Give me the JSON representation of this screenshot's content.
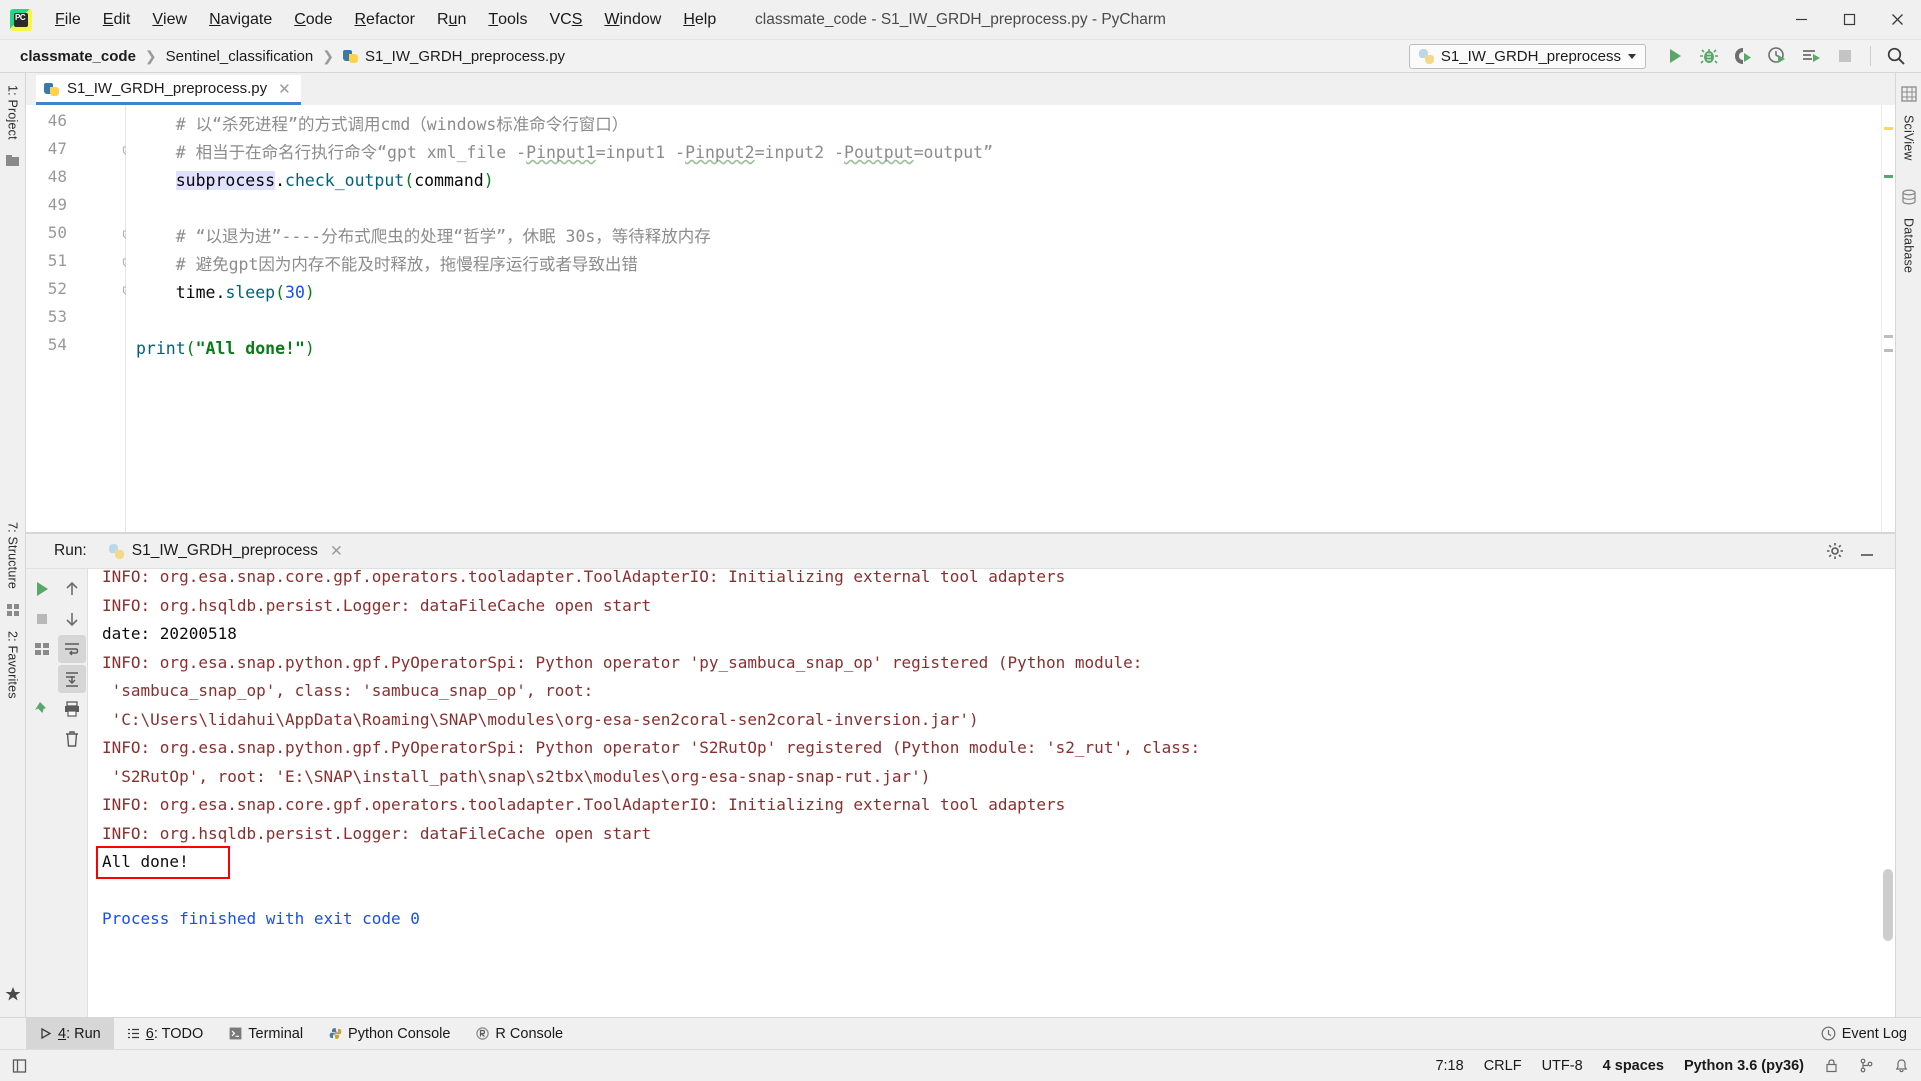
{
  "window": {
    "title": "classmate_code - S1_IW_GRDH_preprocess.py - PyCharm",
    "app_icon": "pycharm-icon",
    "minimize": "─",
    "maximize": "☐",
    "close": "✕"
  },
  "menubar": {
    "items": [
      {
        "label": "File",
        "mnemonic": "F"
      },
      {
        "label": "Edit",
        "mnemonic": "E"
      },
      {
        "label": "View",
        "mnemonic": "V"
      },
      {
        "label": "Navigate",
        "mnemonic": "N"
      },
      {
        "label": "Code",
        "mnemonic": "C"
      },
      {
        "label": "Refactor",
        "mnemonic": "R"
      },
      {
        "label": "Run",
        "mnemonic": "u"
      },
      {
        "label": "Tools",
        "mnemonic": "T"
      },
      {
        "label": "VCS",
        "mnemonic": "S"
      },
      {
        "label": "Window",
        "mnemonic": "W"
      },
      {
        "label": "Help",
        "mnemonic": "H"
      }
    ]
  },
  "breadcrumb": {
    "project": "classmate_code",
    "folder": "Sentinel_classification",
    "file": "S1_IW_GRDH_preprocess.py"
  },
  "toolbar": {
    "run_config": "S1_IW_GRDH_preprocess",
    "buttons": [
      {
        "name": "run-button",
        "tooltip": "Run"
      },
      {
        "name": "debug-button",
        "tooltip": "Debug"
      },
      {
        "name": "run-with-coverage-button",
        "tooltip": "Run with Coverage"
      },
      {
        "name": "profile-button",
        "tooltip": "Profile"
      },
      {
        "name": "run-with-console-button",
        "tooltip": "Run with Console"
      },
      {
        "name": "stop-button",
        "tooltip": "Stop"
      },
      {
        "name": "search-everywhere-button",
        "tooltip": "Search Everywhere"
      }
    ]
  },
  "left_rail": {
    "project_label": "1: Project",
    "structure_label": "7: Structure",
    "favorites_label": "2: Favorites"
  },
  "right_rail": {
    "sciview_label": "SciView",
    "database_label": "Database"
  },
  "editor": {
    "tab_label": "S1_IW_GRDH_preprocess.py",
    "tab_close": "✕",
    "lines": [
      {
        "number": "46",
        "fold": false,
        "tokens": [
          {
            "t": "    # 以“杀死进程”的方式调用cmd（windows标准命令行窗口）",
            "c": "c-com"
          }
        ]
      },
      {
        "number": "47",
        "fold": true,
        "tokens": [
          {
            "t": "    # 相当于在命名行执行命令“gpt xml_file -",
            "c": "c-com"
          },
          {
            "t": "Pinput1",
            "c": "c-com squig"
          },
          {
            "t": "=input1 -",
            "c": "c-com"
          },
          {
            "t": "Pinput2",
            "c": "c-com squig"
          },
          {
            "t": "=input2 -",
            "c": "c-com"
          },
          {
            "t": "Poutput",
            "c": "c-com squig"
          },
          {
            "t": "=output”",
            "c": "c-com"
          }
        ]
      },
      {
        "number": "48",
        "fold": false,
        "tokens": [
          {
            "t": "    ",
            "c": "c-pln"
          },
          {
            "t": "subprocess",
            "c": "c-pln c-hl"
          },
          {
            "t": ".",
            "c": "c-pln"
          },
          {
            "t": "check_output",
            "c": "c-fn"
          },
          {
            "t": "(",
            "c": "c-par"
          },
          {
            "t": "command",
            "c": "c-pln"
          },
          {
            "t": ")",
            "c": "c-par"
          }
        ]
      },
      {
        "number": "49",
        "fold": false,
        "tokens": []
      },
      {
        "number": "50",
        "fold": true,
        "tokens": [
          {
            "t": "    # “以退为进”----分布式爬虫的处理“哲学”，休眠 30s，等待释放内存",
            "c": "c-com"
          }
        ]
      },
      {
        "number": "51",
        "fold": true,
        "tokens": [
          {
            "t": "    # 避免gpt因为内存不能及时释放，拖慢程序运行或者导致出错",
            "c": "c-com"
          }
        ]
      },
      {
        "number": "52",
        "fold": true,
        "tokens": [
          {
            "t": "    ",
            "c": "c-pln"
          },
          {
            "t": "time",
            "c": "c-pln"
          },
          {
            "t": ".",
            "c": "c-pln"
          },
          {
            "t": "sleep",
            "c": "c-fn"
          },
          {
            "t": "(",
            "c": "c-par"
          },
          {
            "t": "30",
            "c": "c-num"
          },
          {
            "t": ")",
            "c": "c-par"
          }
        ]
      },
      {
        "number": "53",
        "fold": false,
        "tokens": []
      },
      {
        "number": "54",
        "fold": false,
        "tokens": [
          {
            "t": "print",
            "c": "c-fn"
          },
          {
            "t": "(",
            "c": "c-par"
          },
          {
            "t": "\"All done!\"",
            "c": "c-str"
          },
          {
            "t": ")",
            "c": "c-par"
          }
        ]
      }
    ]
  },
  "run_window": {
    "label": "Run:",
    "tab_title": "S1_IW_GRDH_preprocess",
    "tab_close": "✕",
    "settings_icon": "gear-icon",
    "minimize_icon": "minimize-icon",
    "rail_buttons": [
      {
        "name": "rerun-button",
        "tooltip": "Rerun"
      },
      {
        "name": "stop-button",
        "tooltip": "Stop"
      },
      {
        "name": "scroll-up-button",
        "tooltip": "Up the Stack Trace"
      },
      {
        "name": "scroll-down-button",
        "tooltip": "Down the Stack Trace"
      },
      {
        "name": "soft-wrap-button",
        "tooltip": "Soft-Wrap"
      },
      {
        "name": "scroll-to-end-button",
        "tooltip": "Scroll to End"
      },
      {
        "name": "print-button",
        "tooltip": "Print"
      },
      {
        "name": "pin-tab-button",
        "tooltip": "Pin Tab"
      },
      {
        "name": "clear-all-button",
        "tooltip": "Clear All"
      }
    ],
    "console_lines": [
      {
        "text": "INFO: org.esa.snap.core.gpf.operators.tooladapter.ToolAdapterIO: Initializing external tool adapters",
        "color": "t-info",
        "clipped": true
      },
      {
        "text": "INFO: org.hsqldb.persist.Logger: dataFileCache open start",
        "color": "t-info"
      },
      {
        "text": "date: 20200518",
        "color": "t-black"
      },
      {
        "text": "INFO: org.esa.snap.python.gpf.PyOperatorSpi: Python operator 'py_sambuca_snap_op' registered (Python module:",
        "color": "t-info"
      },
      {
        "text": " 'sambuca_snap_op', class: 'sambuca_snap_op', root:",
        "color": "t-info"
      },
      {
        "text": " 'C:\\Users\\lidahui\\AppData\\Roaming\\SNAP\\modules\\org-esa-sen2coral-sen2coral-inversion.jar')",
        "color": "t-info"
      },
      {
        "text": "INFO: org.esa.snap.python.gpf.PyOperatorSpi: Python operator 'S2RutOp' registered (Python module: 's2_rut', class:",
        "color": "t-info"
      },
      {
        "text": " 'S2RutOp', root: 'E:\\SNAP\\install_path\\snap\\s2tbx\\modules\\org-esa-snap-snap-rut.jar')",
        "color": "t-info"
      },
      {
        "text": "INFO: org.esa.snap.core.gpf.operators.tooladapter.ToolAdapterIO: Initializing external tool adapters",
        "color": "t-info"
      },
      {
        "text": "INFO: org.hsqldb.persist.Logger: dataFileCache open start",
        "color": "t-info"
      },
      {
        "text": "All done!",
        "color": "t-black",
        "highlighted": true
      },
      {
        "text": "",
        "color": "t-black"
      },
      {
        "text": "Process finished with exit code 0",
        "color": "t-blue"
      }
    ],
    "highlight_color": "#ff0000"
  },
  "bottom_tabs": {
    "items": [
      {
        "label": "4: Run",
        "mnemonic": "4",
        "icon": "run-icon",
        "active": true
      },
      {
        "label": "6: TODO",
        "mnemonic": "6",
        "icon": "todo-icon",
        "active": false
      },
      {
        "label": "Terminal",
        "mnemonic": "",
        "icon": "terminal-icon",
        "active": false
      },
      {
        "label": "Python Console",
        "mnemonic": "",
        "icon": "python-icon",
        "active": false
      },
      {
        "label": "R Console",
        "mnemonic": "",
        "icon": "r-icon",
        "active": false
      }
    ],
    "event_log": "Event Log"
  },
  "statusbar": {
    "caret_position": "7:18",
    "line_separator": "CRLF",
    "encoding": "UTF-8",
    "indent": "4 spaces",
    "interpreter": "Python 3.6 (py36)",
    "icons": [
      "lock-icon",
      "branch-icon",
      "notification-icon"
    ]
  }
}
